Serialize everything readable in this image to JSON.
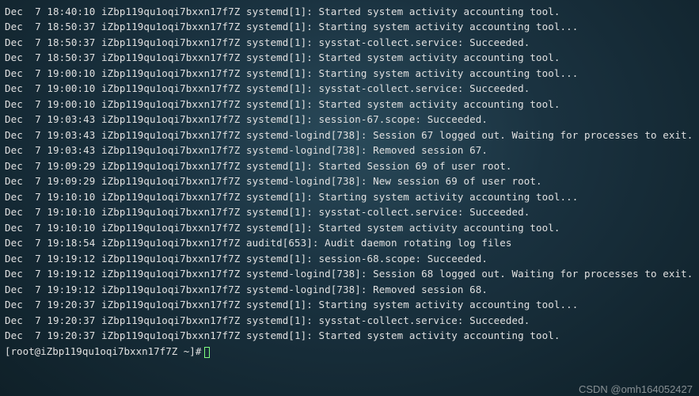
{
  "log_lines": [
    {
      "ts": "Dec  7 18:40:10",
      "host": "iZbp119qu1oqi7bxxn17f7Z",
      "proc": "systemd[1]",
      "msg": "Started system activity accounting tool."
    },
    {
      "ts": "Dec  7 18:50:37",
      "host": "iZbp119qu1oqi7bxxn17f7Z",
      "proc": "systemd[1]",
      "msg": "Starting system activity accounting tool..."
    },
    {
      "ts": "Dec  7 18:50:37",
      "host": "iZbp119qu1oqi7bxxn17f7Z",
      "proc": "systemd[1]",
      "msg": "sysstat-collect.service: Succeeded."
    },
    {
      "ts": "Dec  7 18:50:37",
      "host": "iZbp119qu1oqi7bxxn17f7Z",
      "proc": "systemd[1]",
      "msg": "Started system activity accounting tool."
    },
    {
      "ts": "Dec  7 19:00:10",
      "host": "iZbp119qu1oqi7bxxn17f7Z",
      "proc": "systemd[1]",
      "msg": "Starting system activity accounting tool..."
    },
    {
      "ts": "Dec  7 19:00:10",
      "host": "iZbp119qu1oqi7bxxn17f7Z",
      "proc": "systemd[1]",
      "msg": "sysstat-collect.service: Succeeded."
    },
    {
      "ts": "Dec  7 19:00:10",
      "host": "iZbp119qu1oqi7bxxn17f7Z",
      "proc": "systemd[1]",
      "msg": "Started system activity accounting tool."
    },
    {
      "ts": "Dec  7 19:03:43",
      "host": "iZbp119qu1oqi7bxxn17f7Z",
      "proc": "systemd[1]",
      "msg": "session-67.scope: Succeeded."
    },
    {
      "ts": "Dec  7 19:03:43",
      "host": "iZbp119qu1oqi7bxxn17f7Z",
      "proc": "systemd-logind[738]",
      "msg": "Session 67 logged out. Waiting for processes to exit."
    },
    {
      "ts": "Dec  7 19:03:43",
      "host": "iZbp119qu1oqi7bxxn17f7Z",
      "proc": "systemd-logind[738]",
      "msg": "Removed session 67."
    },
    {
      "ts": "Dec  7 19:09:29",
      "host": "iZbp119qu1oqi7bxxn17f7Z",
      "proc": "systemd[1]",
      "msg": "Started Session 69 of user root."
    },
    {
      "ts": "Dec  7 19:09:29",
      "host": "iZbp119qu1oqi7bxxn17f7Z",
      "proc": "systemd-logind[738]",
      "msg": "New session 69 of user root."
    },
    {
      "ts": "Dec  7 19:10:10",
      "host": "iZbp119qu1oqi7bxxn17f7Z",
      "proc": "systemd[1]",
      "msg": "Starting system activity accounting tool..."
    },
    {
      "ts": "Dec  7 19:10:10",
      "host": "iZbp119qu1oqi7bxxn17f7Z",
      "proc": "systemd[1]",
      "msg": "sysstat-collect.service: Succeeded."
    },
    {
      "ts": "Dec  7 19:10:10",
      "host": "iZbp119qu1oqi7bxxn17f7Z",
      "proc": "systemd[1]",
      "msg": "Started system activity accounting tool."
    },
    {
      "ts": "Dec  7 19:18:54",
      "host": "iZbp119qu1oqi7bxxn17f7Z",
      "proc": "auditd[653]",
      "msg": "Audit daemon rotating log files"
    },
    {
      "ts": "Dec  7 19:19:12",
      "host": "iZbp119qu1oqi7bxxn17f7Z",
      "proc": "systemd[1]",
      "msg": "session-68.scope: Succeeded."
    },
    {
      "ts": "Dec  7 19:19:12",
      "host": "iZbp119qu1oqi7bxxn17f7Z",
      "proc": "systemd-logind[738]",
      "msg": "Session 68 logged out. Waiting for processes to exit."
    },
    {
      "ts": "Dec  7 19:19:12",
      "host": "iZbp119qu1oqi7bxxn17f7Z",
      "proc": "systemd-logind[738]",
      "msg": "Removed session 68."
    },
    {
      "ts": "Dec  7 19:20:37",
      "host": "iZbp119qu1oqi7bxxn17f7Z",
      "proc": "systemd[1]",
      "msg": "Starting system activity accounting tool..."
    },
    {
      "ts": "Dec  7 19:20:37",
      "host": "iZbp119qu1oqi7bxxn17f7Z",
      "proc": "systemd[1]",
      "msg": "sysstat-collect.service: Succeeded."
    },
    {
      "ts": "Dec  7 19:20:37",
      "host": "iZbp119qu1oqi7bxxn17f7Z",
      "proc": "systemd[1]",
      "msg": "Started system activity accounting tool."
    }
  ],
  "prompt": "[root@iZbp119qu1oqi7bxxn17f7Z ~]# ",
  "watermark": "CSDN @omh164052427"
}
